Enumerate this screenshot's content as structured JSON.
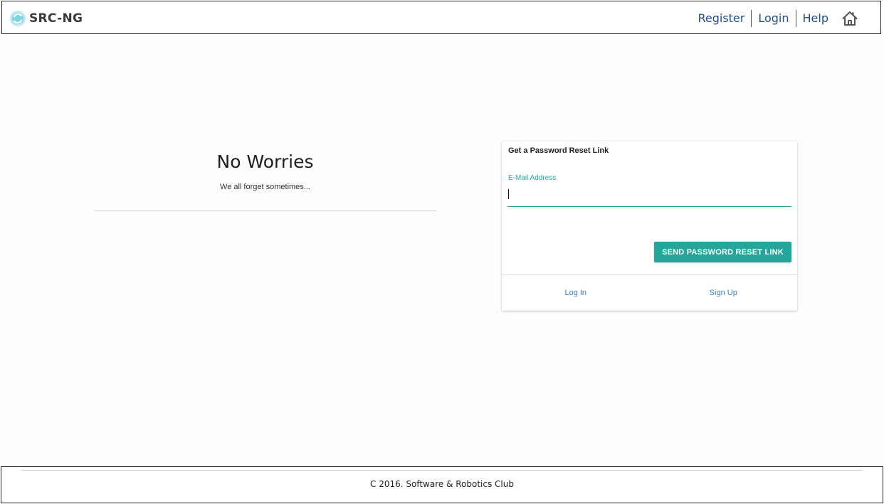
{
  "header": {
    "brand": "SRC-NG",
    "nav": {
      "register": "Register",
      "login": "Login",
      "help": "Help"
    },
    "home_icon": "home-icon",
    "brand_icon": "refresh-globe-icon"
  },
  "hero": {
    "title": "No Worries",
    "subtitle": "We all forget sometimes..."
  },
  "card": {
    "title": "Get a Password Reset Link",
    "email_label": "E-Mail Address",
    "email_value": "",
    "send_button": "SEND PASSWORD RESET LINK",
    "login_link": "Log In",
    "signup_link": "Sign Up"
  },
  "footer": {
    "text": "C 2016. Software & Robotics Club"
  },
  "colors": {
    "accent": "#26a69a",
    "nav_link": "#1e4f8a",
    "card_link": "#3a7cc6"
  }
}
